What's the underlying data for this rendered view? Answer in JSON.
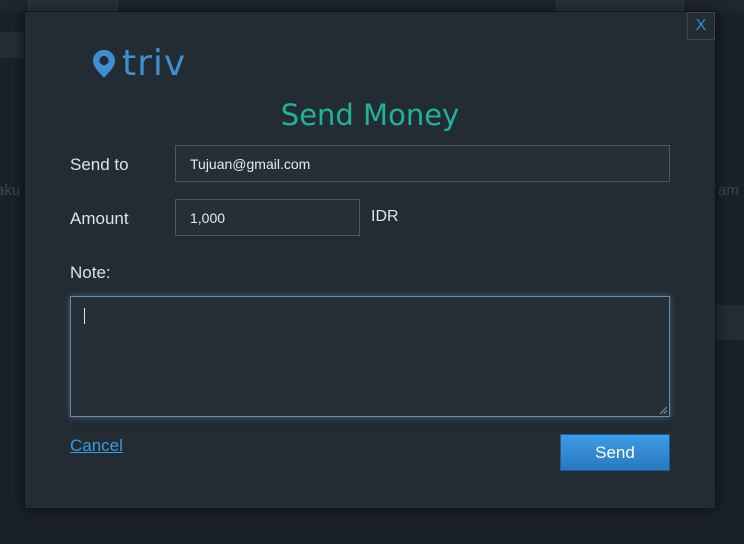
{
  "background": {
    "left_fragment": "aku",
    "right_fragment": "am"
  },
  "dialog": {
    "close_label": "X",
    "logo_text": "triv",
    "title": "Send Money",
    "send_to": {
      "label": "Send to",
      "value": "Tujuan@gmail.com"
    },
    "amount": {
      "label": "Amount",
      "value": "1,000",
      "currency": "IDR"
    },
    "note": {
      "label": "Note:",
      "value": ""
    },
    "cancel_label": "Cancel",
    "send_label": "Send"
  },
  "colors": {
    "accent_teal": "#1fb39a",
    "brand_blue": "#3e8ed0",
    "button_blue": "#3a8fd6",
    "modal_bg": "#232b33"
  }
}
